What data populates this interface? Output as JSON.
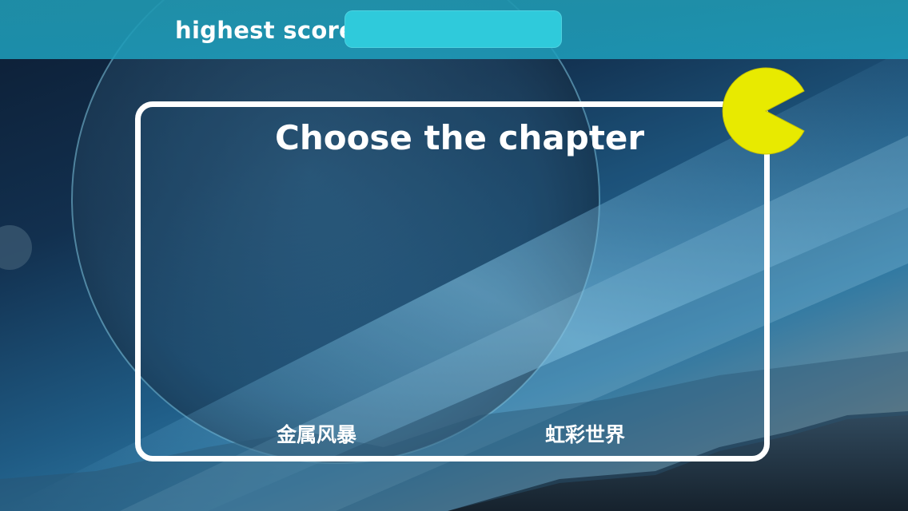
{
  "header": {
    "score_label": "highest score",
    "score_value": ""
  },
  "panel": {
    "title": "Choose the chapter",
    "chapters": [
      {
        "label": "金属风暴"
      },
      {
        "label": "虹彩世界"
      }
    ]
  },
  "colors": {
    "topbar": "#1fa0be",
    "score_box": "#2fcadb",
    "pacman": "#e8ea00",
    "panel_border": "#ffffff"
  },
  "icons": {
    "mascot": "pacman-icon"
  }
}
